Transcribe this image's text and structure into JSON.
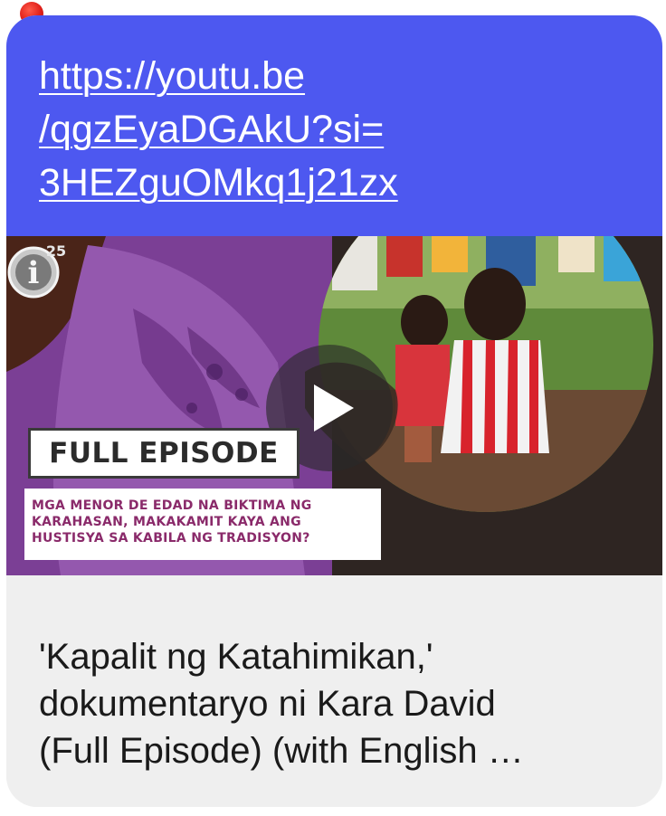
{
  "link": {
    "line1": "https://youtu.be",
    "line2": "/qgzEyaDGAkU?si=",
    "line3": "3HEZguOMkq1j21zx"
  },
  "thumbnail": {
    "badge": "FULL EPISODE",
    "subtitle_line1": "MGA MENOR DE EDAD NA BIKTIMA NG",
    "subtitle_line2": "KARAHASAN, MAKAKAMIT KAYA ANG",
    "subtitle_line3": "HUSTISYA SA KABILA NG TRADISYON?",
    "logo_text": "i",
    "logo_super": "25"
  },
  "video": {
    "title_line1": "'Kapalit ng Katahimikan,'",
    "title_line2": "dokumentaryo ni Kara David",
    "title_line3": "(Full Episode) (with English …"
  },
  "icons": {
    "play": "play-icon",
    "notification": "notification-dot-icon"
  },
  "colors": {
    "link_bg": "#4d58f0",
    "card_bg": "#efefef",
    "notification_dot": "#e0201a"
  }
}
